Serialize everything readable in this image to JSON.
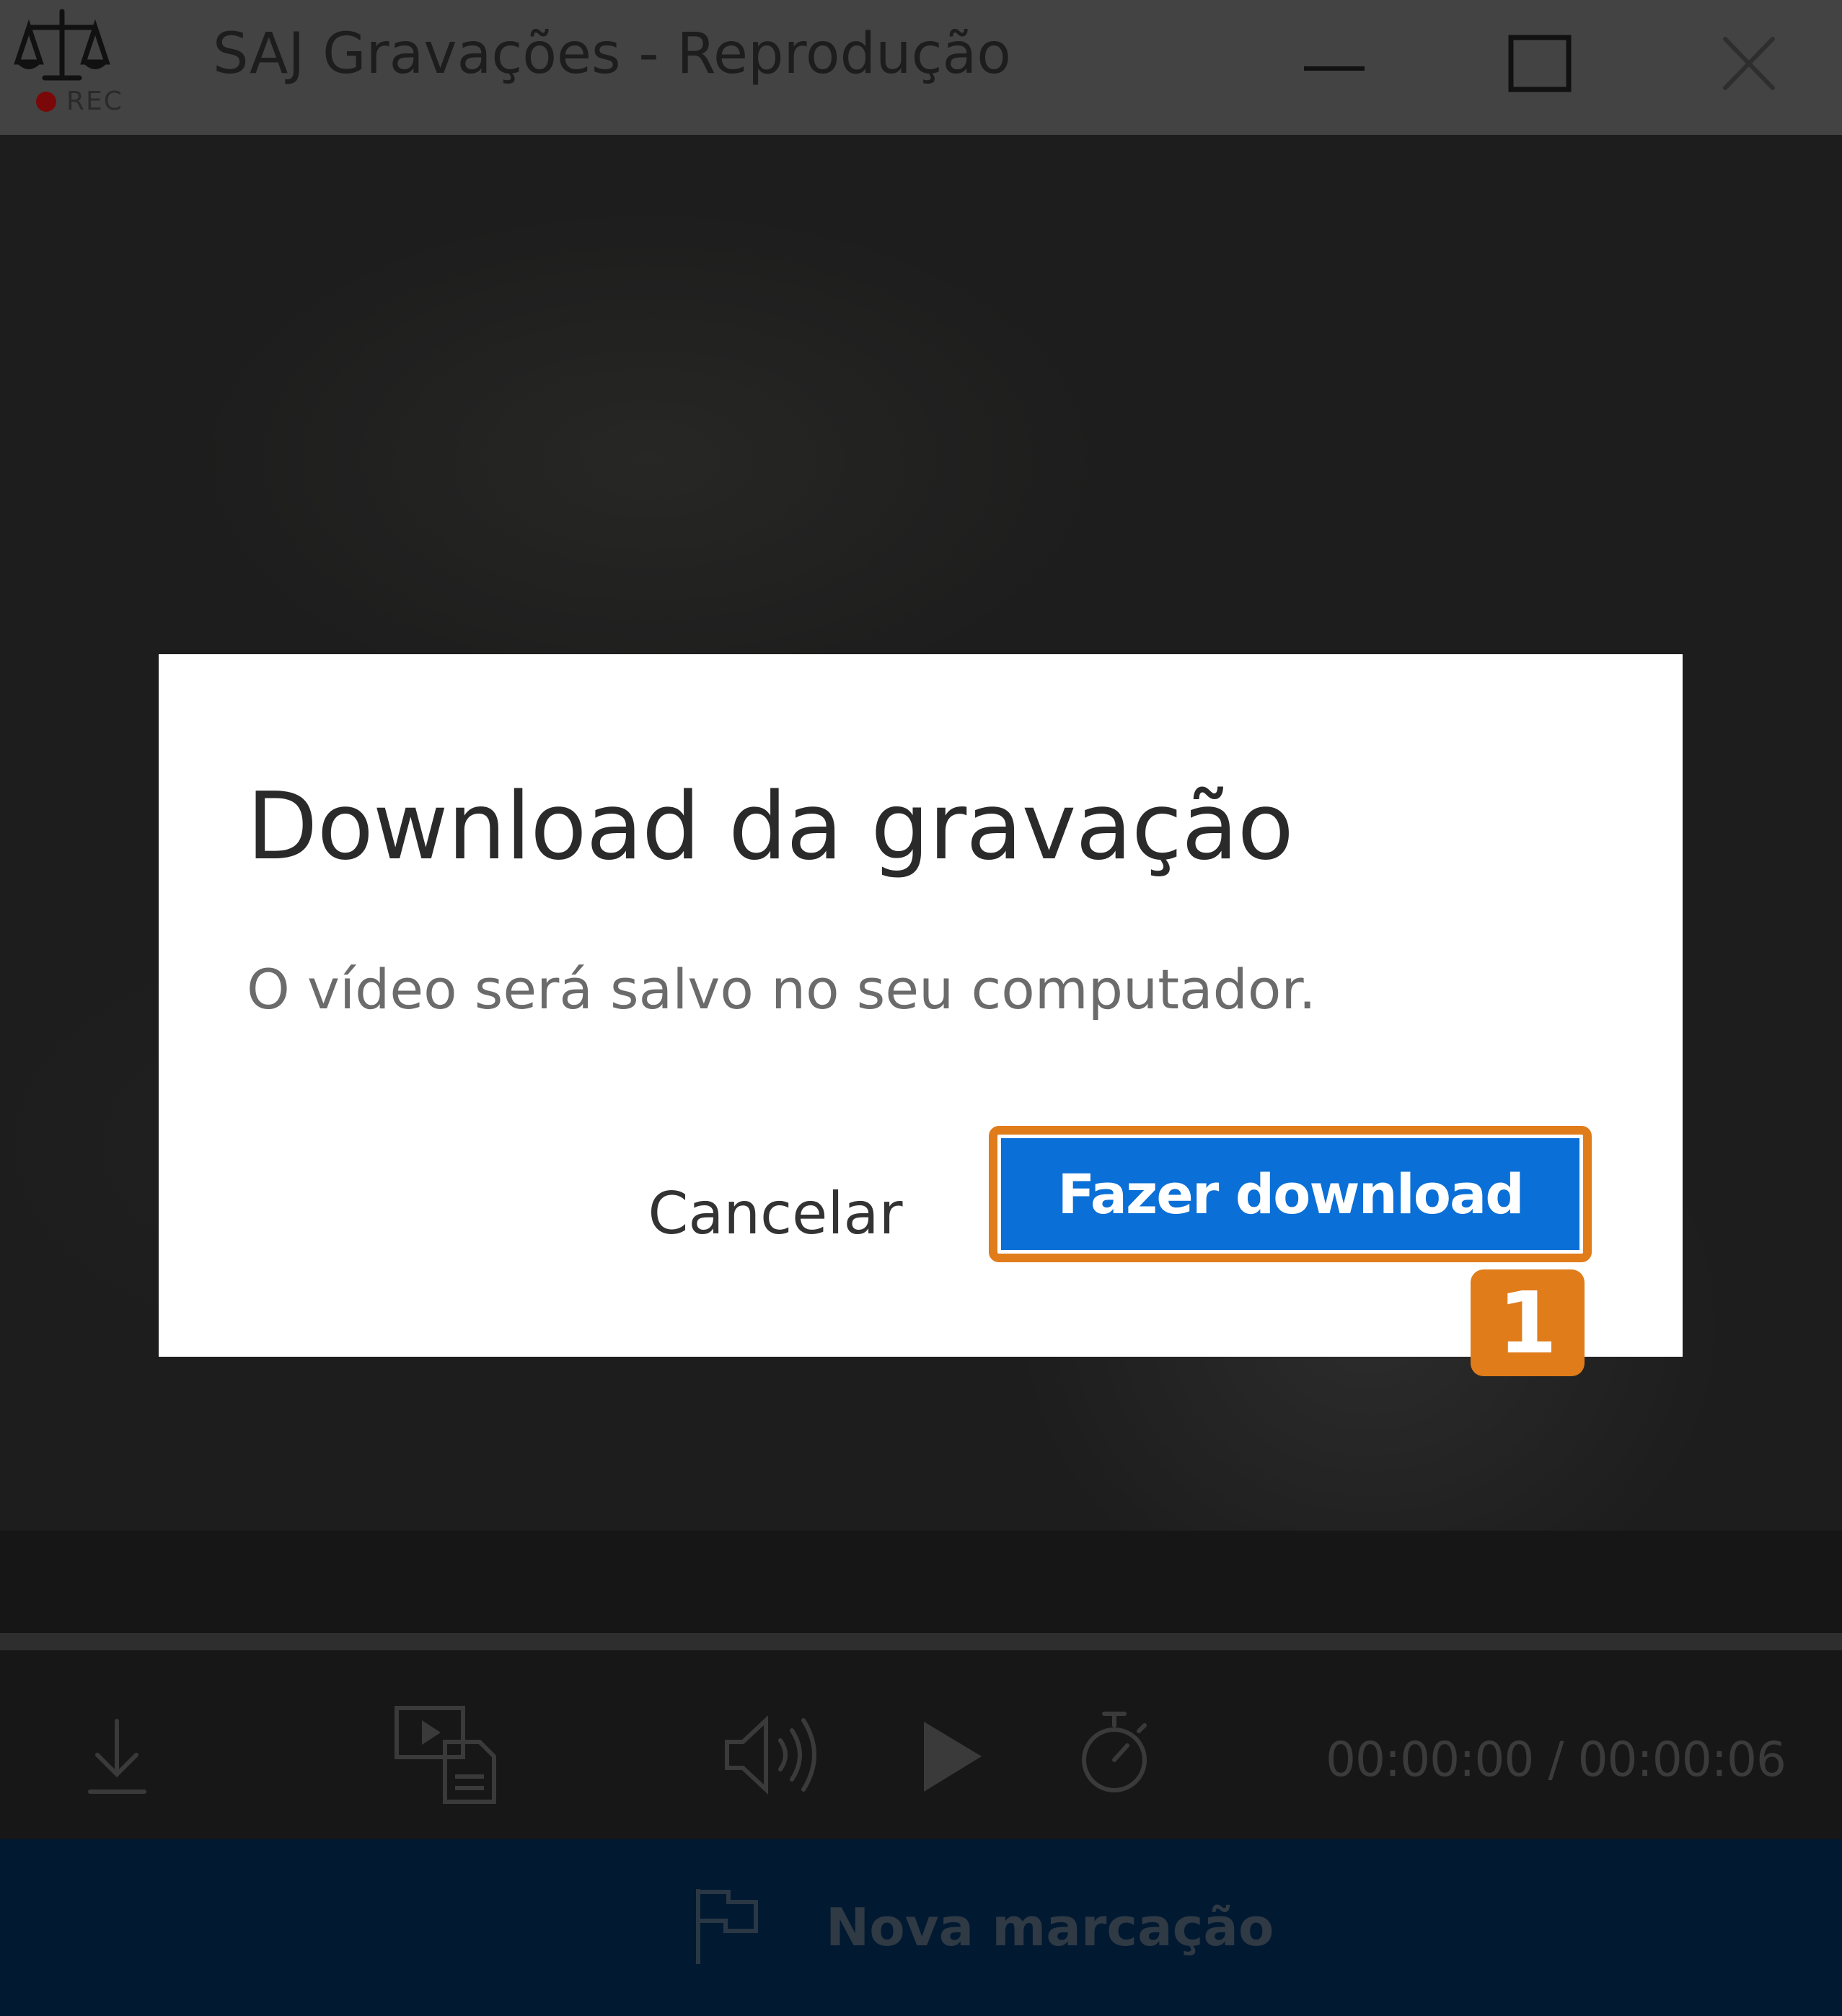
{
  "window": {
    "title": "SAJ Gravações - Reprodução",
    "logo_icon": "scales-of-justice-icon",
    "rec_label": "REC"
  },
  "dialog": {
    "title": "Download da gravação",
    "message": "O vídeo será salvo no seu computador.",
    "cancel_label": "Cancelar",
    "confirm_label": "Fazer download"
  },
  "annotation": {
    "step_number": "1",
    "color": "#e07c1a"
  },
  "controls": {
    "icons": [
      "download-icon",
      "transcript-icon",
      "volume-icon",
      "play-icon",
      "timer-icon"
    ],
    "time": "00:00:00 / 00:00:06"
  },
  "marker_bar": {
    "icon": "flag-icon",
    "label": "Nova marcação"
  },
  "colors": {
    "titlebar": "#434343",
    "primary_button": "#0a6fd6",
    "marker_bar": "#011931",
    "highlight": "#e07c1a"
  }
}
